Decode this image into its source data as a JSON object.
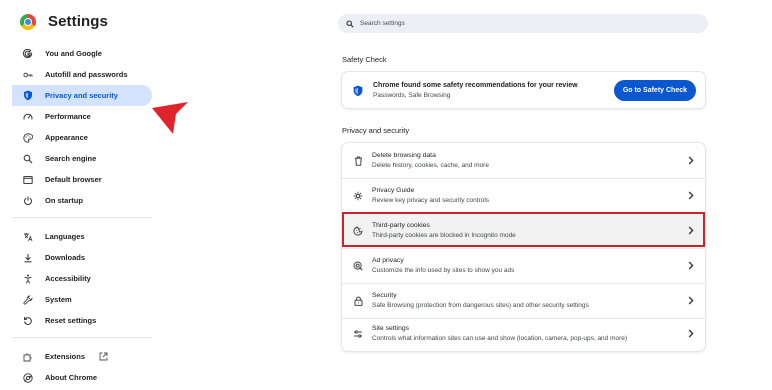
{
  "app": {
    "title": "Settings",
    "logo_icon": "chrome-logo-icon"
  },
  "search": {
    "placeholder": "Search settings"
  },
  "sidebar": {
    "items": [
      {
        "label": "You and Google",
        "icon": "google-g-icon",
        "active": false
      },
      {
        "label": "Autofill and passwords",
        "icon": "key-icon",
        "active": false
      },
      {
        "label": "Privacy and security",
        "icon": "shield-icon",
        "active": true
      },
      {
        "label": "Performance",
        "icon": "speedometer-icon",
        "active": false
      },
      {
        "label": "Appearance",
        "icon": "palette-icon",
        "active": false
      },
      {
        "label": "Search engine",
        "icon": "search-icon",
        "active": false
      },
      {
        "label": "Default browser",
        "icon": "browser-window-icon",
        "active": false
      },
      {
        "label": "On startup",
        "icon": "power-icon",
        "active": false
      },
      {
        "label": "Languages",
        "icon": "translate-icon",
        "active": false
      },
      {
        "label": "Downloads",
        "icon": "download-icon",
        "active": false
      },
      {
        "label": "Accessibility",
        "icon": "accessibility-icon",
        "active": false
      },
      {
        "label": "System",
        "icon": "wrench-icon",
        "active": false
      },
      {
        "label": "Reset settings",
        "icon": "reset-icon",
        "active": false
      },
      {
        "label": "Extensions",
        "icon": "puzzle-icon",
        "active": false
      },
      {
        "label": "About Chrome",
        "icon": "chrome-icon",
        "active": false
      }
    ]
  },
  "safety_check": {
    "section_title": "Safety Check",
    "title": "Chrome found some safety recommendations for your review",
    "subtitle": "Passwords, Safe Browsing",
    "button": "Go to Safety Check"
  },
  "privacy": {
    "section_title": "Privacy and security",
    "rows": [
      {
        "title": "Delete browsing data",
        "subtitle": "Delete history, cookies, cache, and more",
        "icon": "trash-icon"
      },
      {
        "title": "Privacy Guide",
        "subtitle": "Review key privacy and security controls",
        "icon": "privacy-guide-icon"
      },
      {
        "title": "Third-party cookies",
        "subtitle": "Third-party cookies are blocked in Incognito mode",
        "icon": "cookie-icon"
      },
      {
        "title": "Ad privacy",
        "subtitle": "Customize the info used by sites to show you ads",
        "icon": "ad-privacy-icon"
      },
      {
        "title": "Security",
        "subtitle": "Safe Browsing (protection from dangerous sites) and other security settings",
        "icon": "lock-icon"
      },
      {
        "title": "Site settings",
        "subtitle": "Controls what information sites can use and show (location, camera, pop-ups, and more)",
        "icon": "sliders-icon"
      }
    ]
  },
  "colors": {
    "accent": "#0b57d0",
    "active_bg": "#d3e3fd",
    "highlight": "#c8242c"
  }
}
